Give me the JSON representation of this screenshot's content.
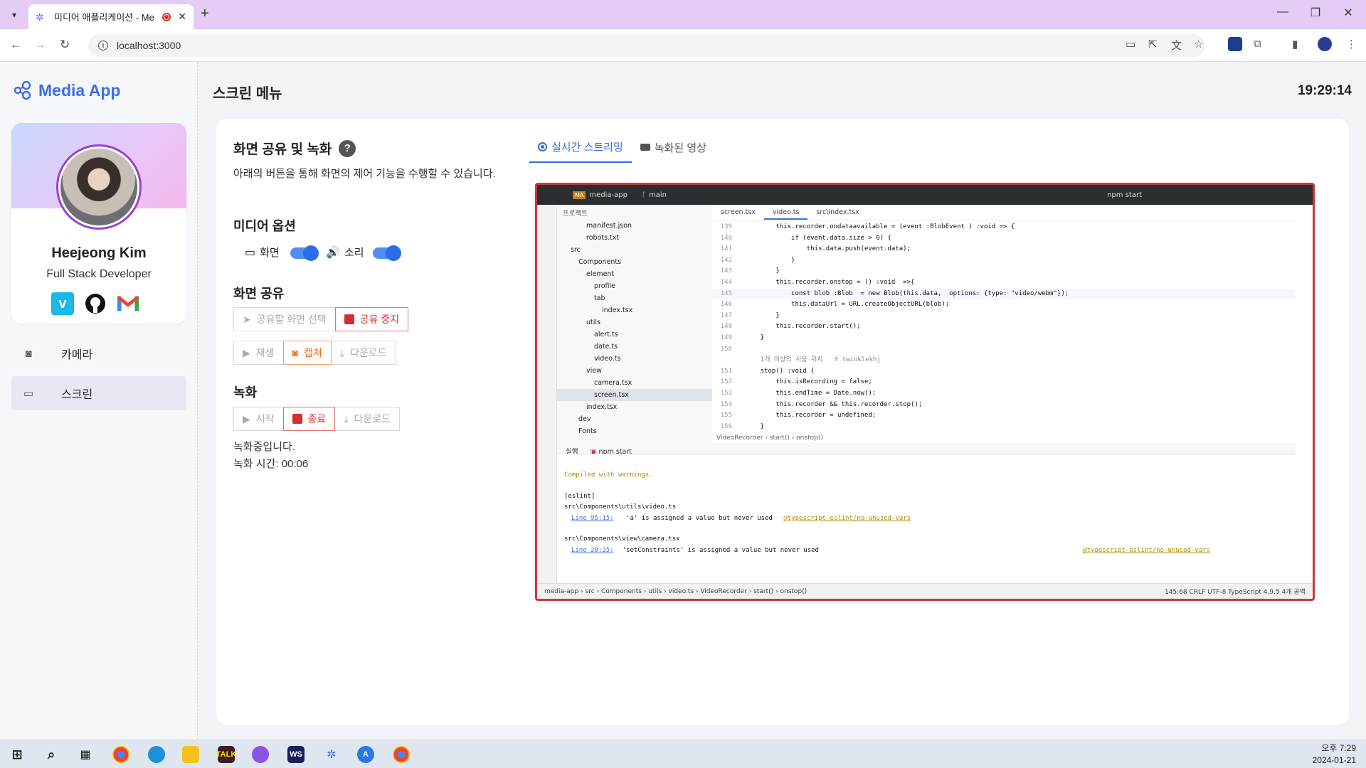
{
  "browser": {
    "tab_title": "미디어 애플리케이션 - Me",
    "url": "localhost:3000"
  },
  "app": {
    "brand": "Media App",
    "page_title": "스크린 메뉴",
    "clock": "19:29:14",
    "profile": {
      "name": "Heejeong Kim",
      "role": "Full Stack Developer"
    },
    "nav": [
      {
        "label": "카메라",
        "icon": "camera-icon"
      },
      {
        "label": "스크린",
        "icon": "monitor-icon"
      }
    ],
    "controls": {
      "title": "화면 공유 및 녹화",
      "description": "아래의 버튼을 통해 화면의 제어 기능을 수행할 수 있습니다.",
      "media_options_title": "미디어 옵션",
      "option_screen": "화면",
      "option_sound": "소리",
      "share_title": "화면 공유",
      "share_select": "공유할 화면 선택",
      "share_stop": "공유 중지",
      "play": "재생",
      "capture": "캡처",
      "download": "다운로드",
      "record_title": "녹화",
      "record_start": "시작",
      "record_stop": "종료",
      "record_download": "다운로드",
      "recording_status": "녹화중입니다.",
      "recording_time": "녹화 시간: 00:06"
    },
    "preview_tabs": [
      "실시간 스트리밍",
      "녹화된 영상"
    ],
    "accent": "#2d6de8",
    "danger": "#d32f2f",
    "warning": "#f46a1c"
  },
  "ide": {
    "project": "media-app",
    "branch": "main",
    "run_config": "npm start",
    "project_label": "프로젝트",
    "tree": [
      {
        "name": "manifest.json",
        "indent": 3
      },
      {
        "name": "robots.txt",
        "indent": 3
      },
      {
        "name": "src",
        "indent": 1
      },
      {
        "name": "Components",
        "indent": 2
      },
      {
        "name": "element",
        "indent": 3
      },
      {
        "name": "profile",
        "indent": 4
      },
      {
        "name": "tab",
        "indent": 4
      },
      {
        "name": "index.tsx",
        "indent": 5
      },
      {
        "name": "utils",
        "indent": 3
      },
      {
        "name": "alert.ts",
        "indent": 4
      },
      {
        "name": "date.ts",
        "indent": 4
      },
      {
        "name": "video.ts",
        "indent": 4
      },
      {
        "name": "view",
        "indent": 3
      },
      {
        "name": "camera.tsx",
        "indent": 4
      },
      {
        "name": "screen.tsx",
        "indent": 4
      },
      {
        "name": "index.tsx",
        "indent": 3
      },
      {
        "name": "dev",
        "indent": 2
      },
      {
        "name": "Fonts",
        "indent": 2
      }
    ],
    "editor_tabs": [
      "screen.tsx",
      "video.ts",
      "src\\index.tsx"
    ],
    "code": [
      {
        "ln": "139",
        "text": "        this.recorder.ondataavailable = (event :BlobEvent ) :void => {"
      },
      {
        "ln": "140",
        "text": "            if (event.data.size > 0) {"
      },
      {
        "ln": "141",
        "text": "                this.data.push(event.data);"
      },
      {
        "ln": "142",
        "text": "            }"
      },
      {
        "ln": "143",
        "text": "        }"
      },
      {
        "ln": "144",
        "text": "        this.recorder.onstop = () :void  =>{"
      },
      {
        "ln": "145",
        "text": "            const blob :Blob  = new Blob(this.data,  options: {type: \"video/webm\"});"
      },
      {
        "ln": "146",
        "text": "            this.dataUrl = URL.createObjectURL(blob);"
      },
      {
        "ln": "147",
        "text": "        }"
      },
      {
        "ln": "148",
        "text": "        this.recorder.start();"
      },
      {
        "ln": "149",
        "text": "    }"
      },
      {
        "ln": "150",
        "text": ""
      },
      {
        "ln": "",
        "text": "    1개 이상의 사용 위치   ≗ twinklekhj"
      },
      {
        "ln": "151",
        "text": "    stop() :void {"
      },
      {
        "ln": "152",
        "text": "        this.isRecording = false;"
      },
      {
        "ln": "153",
        "text": "        this.endTime = Date.now();"
      },
      {
        "ln": "154",
        "text": "        this.recorder && this.recorder.stop();"
      },
      {
        "ln": "155",
        "text": "        this.recorder = undefined;"
      },
      {
        "ln": "156",
        "text": "    }"
      }
    ],
    "breadcrumb": "VideoRecorder  ›  start()  ›  onstop()",
    "terminal_tab_label": "실행",
    "terminal_tab": "npm start",
    "terminal": {
      "compiled": "Compiled with warnings.",
      "eslint": "[eslint]",
      "file1": "src\\Components\\utils\\video.ts",
      "line1": "Line 95:15:",
      "msg1": "'a' is assigned a value but never used",
      "rule1": "@typescript-eslint/no-unused-vars",
      "file2": "src\\Components\\view\\camera.tsx",
      "line2": "Line 28:25:",
      "msg2": "'setConstraints' is assigned a value but never used",
      "rule2": "@typescript-eslint/no-unused-vars"
    },
    "status_path": "media-app › src › Components › utils › video.ts › VideoRecorder › start() › onstop()",
    "status_right": "145:68    CRLF    UTF-8    TypeScript 4.9.5    4개 공백"
  },
  "taskbar": {
    "time": "오후 7:29",
    "date": "2024-01-21"
  }
}
